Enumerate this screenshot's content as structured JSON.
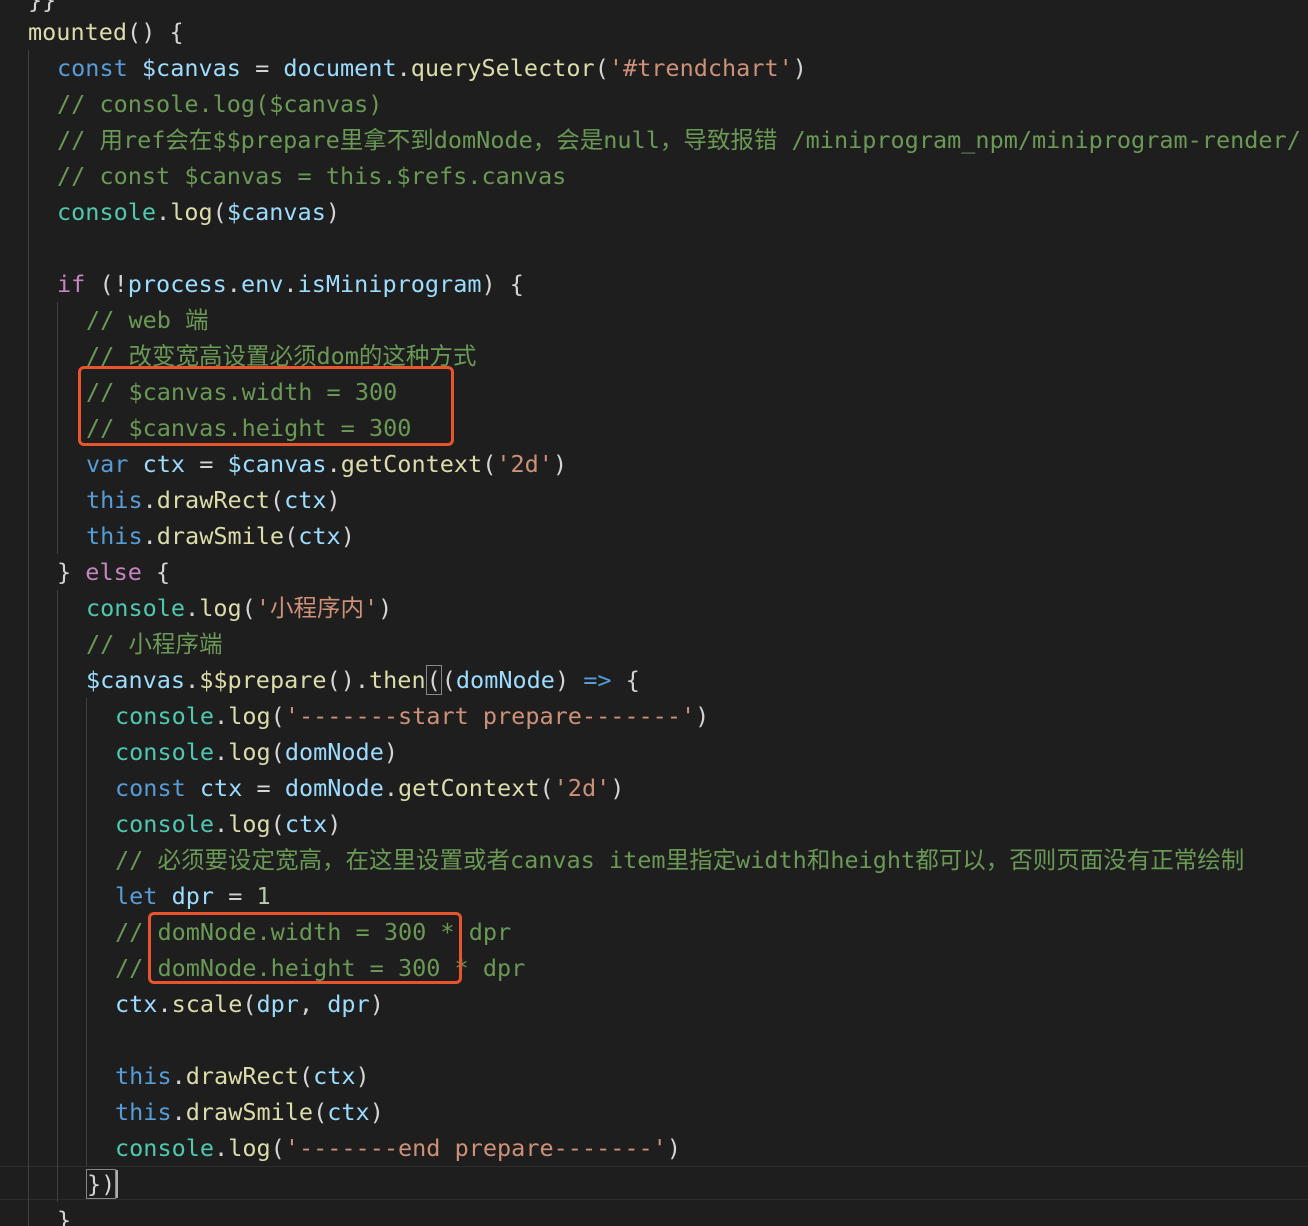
{
  "editor": {
    "colors": {
      "background": "#1e1e1e",
      "plain": "#d4d4d4",
      "keyword": "#569cd6",
      "control": "#c586c0",
      "variable": "#9cdcfe",
      "function": "#dcdcaa",
      "string": "#ce9178",
      "comment": "#6a9955",
      "number": "#b5cea8",
      "class": "#4ec9b0",
      "highlight_box": "#e8542c"
    },
    "lines": [
      {
        "tokens": [
          [
            "}}",
            "plain"
          ]
        ]
      },
      {
        "tokens": [
          [
            "mounted",
            "function"
          ],
          [
            "() {",
            "plain"
          ]
        ]
      },
      {
        "tokens": [
          [
            "const",
            "keyword"
          ],
          [
            " ",
            "plain"
          ],
          [
            "$canvas",
            "variable"
          ],
          [
            " = ",
            "plain"
          ],
          [
            "document",
            "variable"
          ],
          [
            ".",
            "plain"
          ],
          [
            "querySelector",
            "function"
          ],
          [
            "(",
            "plain"
          ],
          [
            "'#trendchart'",
            "string"
          ],
          [
            ")",
            "plain"
          ]
        ]
      },
      {
        "tokens": [
          [
            "// console.log($canvas)",
            "comment"
          ]
        ]
      },
      {
        "tokens": [
          [
            "// 用ref会在$$prepare里拿不到domNode，会是null，导致报错 /miniprogram_npm/miniprogram-render/",
            "comment"
          ]
        ]
      },
      {
        "tokens": [
          [
            "// const $canvas = this.$refs.canvas",
            "comment"
          ]
        ]
      },
      {
        "tokens": [
          [
            "console",
            "class"
          ],
          [
            ".",
            "plain"
          ],
          [
            "log",
            "function"
          ],
          [
            "(",
            "plain"
          ],
          [
            "$canvas",
            "variable"
          ],
          [
            ")",
            "plain"
          ]
        ]
      },
      {
        "tokens": []
      },
      {
        "tokens": [
          [
            "if",
            "control"
          ],
          [
            " (!",
            "plain"
          ],
          [
            "process",
            "variable"
          ],
          [
            ".",
            "plain"
          ],
          [
            "env",
            "variable"
          ],
          [
            ".",
            "plain"
          ],
          [
            "isMiniprogram",
            "variable"
          ],
          [
            ") {",
            "plain"
          ]
        ]
      },
      {
        "tokens": [
          [
            "// web 端",
            "comment"
          ]
        ]
      },
      {
        "tokens": [
          [
            "// 改变宽高设置必须dom的这种方式",
            "comment"
          ]
        ]
      },
      {
        "tokens": [
          [
            "// $canvas.width = 300",
            "comment"
          ]
        ]
      },
      {
        "tokens": [
          [
            "// $canvas.height = 300",
            "comment"
          ]
        ]
      },
      {
        "tokens": [
          [
            "var",
            "keyword"
          ],
          [
            " ",
            "plain"
          ],
          [
            "ctx",
            "variable"
          ],
          [
            " = ",
            "plain"
          ],
          [
            "$canvas",
            "variable"
          ],
          [
            ".",
            "plain"
          ],
          [
            "getContext",
            "function"
          ],
          [
            "(",
            "plain"
          ],
          [
            "'2d'",
            "string"
          ],
          [
            ")",
            "plain"
          ]
        ]
      },
      {
        "tokens": [
          [
            "this",
            "keyword"
          ],
          [
            ".",
            "plain"
          ],
          [
            "drawRect",
            "function"
          ],
          [
            "(",
            "plain"
          ],
          [
            "ctx",
            "variable"
          ],
          [
            ")",
            "plain"
          ]
        ]
      },
      {
        "tokens": [
          [
            "this",
            "keyword"
          ],
          [
            ".",
            "plain"
          ],
          [
            "drawSmile",
            "function"
          ],
          [
            "(",
            "plain"
          ],
          [
            "ctx",
            "variable"
          ],
          [
            ")",
            "plain"
          ]
        ]
      },
      {
        "tokens": [
          [
            "} ",
            "plain"
          ],
          [
            "else",
            "control"
          ],
          [
            " {",
            "plain"
          ]
        ]
      },
      {
        "tokens": [
          [
            "console",
            "class"
          ],
          [
            ".",
            "plain"
          ],
          [
            "log",
            "function"
          ],
          [
            "(",
            "plain"
          ],
          [
            "'小程序内'",
            "string"
          ],
          [
            ")",
            "plain"
          ]
        ]
      },
      {
        "tokens": [
          [
            "// 小程序端",
            "comment"
          ]
        ]
      },
      {
        "tokens": [
          [
            "$canvas",
            "variable"
          ],
          [
            ".",
            "plain"
          ],
          [
            "$$prepare",
            "function"
          ],
          [
            "().",
            "plain"
          ],
          [
            "then",
            "function"
          ],
          [
            "(",
            "bracket"
          ],
          [
            "(",
            "plain"
          ],
          [
            "domNode",
            "variable"
          ],
          [
            ") ",
            "plain"
          ],
          [
            "=>",
            "keyword"
          ],
          [
            " {",
            "plain"
          ]
        ]
      },
      {
        "tokens": [
          [
            "console",
            "class"
          ],
          [
            ".",
            "plain"
          ],
          [
            "log",
            "function"
          ],
          [
            "(",
            "plain"
          ],
          [
            "'-------start prepare-------'",
            "string"
          ],
          [
            ")",
            "plain"
          ]
        ]
      },
      {
        "tokens": [
          [
            "console",
            "class"
          ],
          [
            ".",
            "plain"
          ],
          [
            "log",
            "function"
          ],
          [
            "(",
            "plain"
          ],
          [
            "domNode",
            "variable"
          ],
          [
            ")",
            "plain"
          ]
        ]
      },
      {
        "tokens": [
          [
            "const",
            "keyword"
          ],
          [
            " ",
            "plain"
          ],
          [
            "ctx",
            "variable"
          ],
          [
            " = ",
            "plain"
          ],
          [
            "domNode",
            "variable"
          ],
          [
            ".",
            "plain"
          ],
          [
            "getContext",
            "function"
          ],
          [
            "(",
            "plain"
          ],
          [
            "'2d'",
            "string"
          ],
          [
            ")",
            "plain"
          ]
        ]
      },
      {
        "tokens": [
          [
            "console",
            "class"
          ],
          [
            ".",
            "plain"
          ],
          [
            "log",
            "function"
          ],
          [
            "(",
            "plain"
          ],
          [
            "ctx",
            "variable"
          ],
          [
            ")",
            "plain"
          ]
        ]
      },
      {
        "tokens": [
          [
            "// 必须要设定宽高，在这里设置或者canvas item里指定width和height都可以，否则页面没有正常绘制",
            "comment"
          ]
        ]
      },
      {
        "tokens": [
          [
            "let",
            "keyword"
          ],
          [
            " ",
            "plain"
          ],
          [
            "dpr",
            "variable"
          ],
          [
            " = ",
            "plain"
          ],
          [
            "1",
            "number"
          ]
        ]
      },
      {
        "tokens": [
          [
            "// domNode.width = 300 * dpr",
            "comment"
          ]
        ]
      },
      {
        "tokens": [
          [
            "// domNode.height = 300 * dpr",
            "comment"
          ]
        ]
      },
      {
        "tokens": [
          [
            "ctx",
            "variable"
          ],
          [
            ".",
            "plain"
          ],
          [
            "scale",
            "function"
          ],
          [
            "(",
            "plain"
          ],
          [
            "dpr",
            "variable"
          ],
          [
            ", ",
            "plain"
          ],
          [
            "dpr",
            "variable"
          ],
          [
            ")",
            "plain"
          ]
        ]
      },
      {
        "tokens": []
      },
      {
        "tokens": [
          [
            "this",
            "keyword"
          ],
          [
            ".",
            "plain"
          ],
          [
            "drawRect",
            "function"
          ],
          [
            "(",
            "plain"
          ],
          [
            "ctx",
            "variable"
          ],
          [
            ")",
            "plain"
          ]
        ]
      },
      {
        "tokens": [
          [
            "this",
            "keyword"
          ],
          [
            ".",
            "plain"
          ],
          [
            "drawSmile",
            "function"
          ],
          [
            "(",
            "plain"
          ],
          [
            "ctx",
            "variable"
          ],
          [
            ")",
            "plain"
          ]
        ]
      },
      {
        "tokens": [
          [
            "console",
            "class"
          ],
          [
            ".",
            "plain"
          ],
          [
            "log",
            "function"
          ],
          [
            "(",
            "plain"
          ],
          [
            "'-------end prepare-------'",
            "string"
          ],
          [
            ")",
            "plain"
          ]
        ]
      },
      {
        "tokens": [
          [
            "})",
            "bracket"
          ]
        ]
      },
      {
        "tokens": [
          [
            "}",
            "plain"
          ]
        ]
      }
    ]
  }
}
